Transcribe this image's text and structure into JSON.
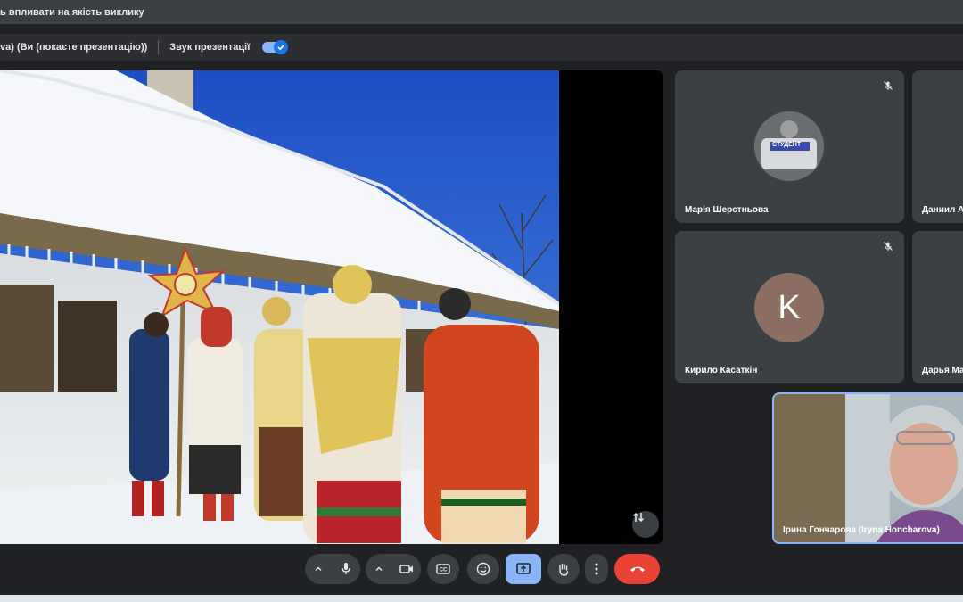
{
  "warning_bar": {
    "text": "ь впливати на якість виклику"
  },
  "presentation_bar": {
    "presenter_text": "va) (Ви (покаєте презентацію))",
    "audio_label": "Звук презентації",
    "audio_enabled": true
  },
  "participants": [
    {
      "name": "Марія Шерстньова",
      "muted": true,
      "avatar_type": "photo"
    },
    {
      "name": "Даниил А",
      "muted": false,
      "avatar_type": "none"
    },
    {
      "name": "Кирило Касаткін",
      "muted": true,
      "avatar_type": "letter",
      "avatar_letter": "K",
      "avatar_color": "#8d6e63"
    },
    {
      "name": "Дарья Ма",
      "muted": false,
      "avatar_type": "none"
    }
  ],
  "self_view": {
    "name": "Ірина Гончарова (Iryna Honcharova)"
  },
  "avatar_sticker_text": "СТУДЕНТ",
  "controls": {
    "mic_icon": "mic-icon",
    "camera_icon": "camera-icon",
    "captions_icon": "captions-icon",
    "emoji_icon": "emoji-icon",
    "present_icon": "present-screen-icon",
    "hand_icon": "raise-hand-icon",
    "more_icon": "more-options-icon",
    "end_call_icon": "end-call-icon",
    "end_call_color": "#ea4335",
    "present_active_color": "#8ab4f8"
  }
}
